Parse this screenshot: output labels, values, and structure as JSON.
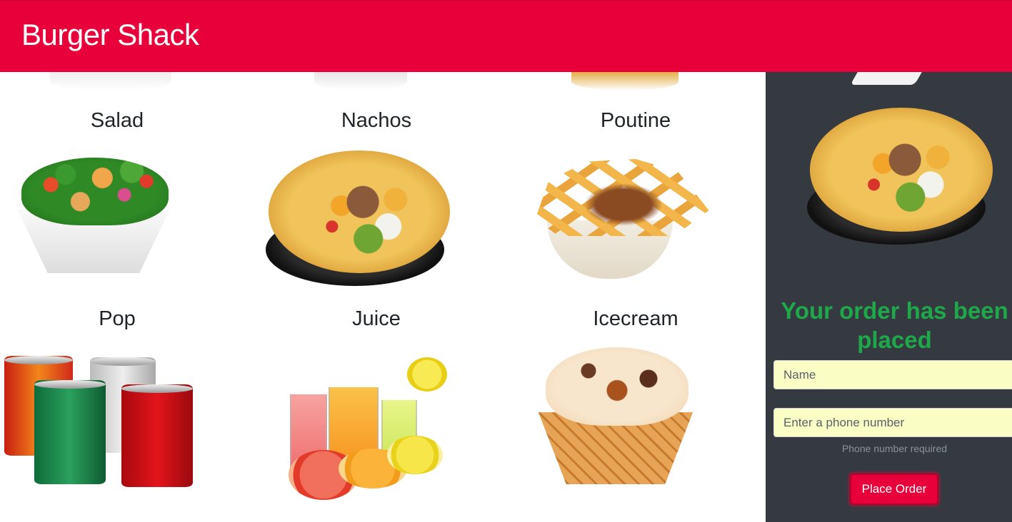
{
  "navbar": {
    "brand": "Burger Shack",
    "background_color": "#e8003a"
  },
  "menu": {
    "items": [
      {
        "name": "Salad",
        "image": "salad-image"
      },
      {
        "name": "Nachos",
        "image": "nachos-image"
      },
      {
        "name": "Poutine",
        "image": "poutine-image"
      },
      {
        "name": "Pop",
        "image": "pop-cans-image"
      },
      {
        "name": "Juice",
        "image": "juice-glasses-image"
      },
      {
        "name": "Icecream",
        "image": "icecream-image"
      }
    ]
  },
  "order_panel": {
    "background_color": "#343a40",
    "selected_item_image": "nachos-image",
    "status_message": "Your order has been placed",
    "status_color": "#1ea84a",
    "name_field": {
      "placeholder": "Name",
      "value": ""
    },
    "phone_field": {
      "placeholder": "Enter a phone number",
      "value": ""
    },
    "phone_help": "Phone number required",
    "place_order_label": "Place Order"
  }
}
